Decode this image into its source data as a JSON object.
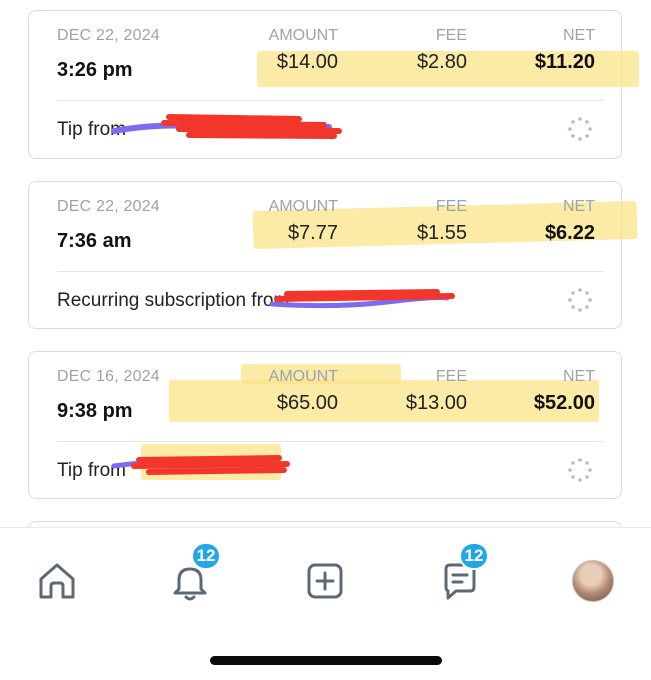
{
  "labels": {
    "amount": "AMOUNT",
    "fee": "FEE",
    "net": "NET"
  },
  "transactions": [
    {
      "date": "DEC 22, 2024",
      "time": "3:26 pm",
      "amount": "$14.00",
      "fee": "$2.80",
      "net": "$11.20",
      "description": "Tip from"
    },
    {
      "date": "DEC 22, 2024",
      "time": "7:36 am",
      "amount": "$7.77",
      "fee": "$1.55",
      "net": "$6.22",
      "description": "Recurring subscription from"
    },
    {
      "date": "DEC 16, 2024",
      "time": "9:38 pm",
      "amount": "$65.00",
      "fee": "$13.00",
      "net": "$52.00",
      "description": "Tip from"
    }
  ],
  "tabbar": {
    "notifications_badge": "12",
    "messages_badge": "12"
  },
  "colors": {
    "accent": "#22a6e6",
    "highlight": "#fbe38a",
    "redaction_red": "#f2362b",
    "redaction_purple": "#7b6cf0",
    "muted_text": "#9ba3ad"
  },
  "icons": [
    "home-icon",
    "bell-icon",
    "add-square-icon",
    "message-icon",
    "spinner-icon"
  ]
}
